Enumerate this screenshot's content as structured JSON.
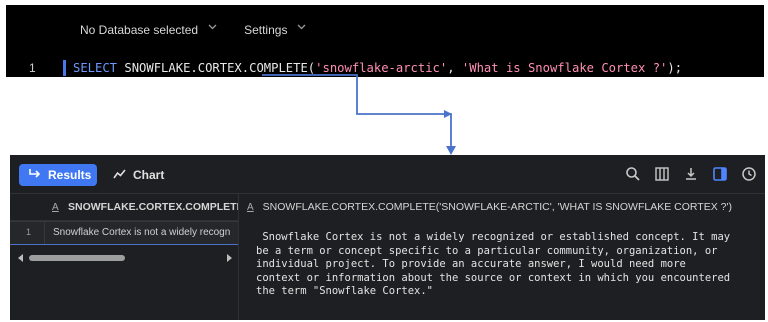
{
  "editor": {
    "database_selector": "No Database selected",
    "settings_label": "Settings",
    "line_number": "1",
    "code": {
      "select_kw": "SELECT",
      "function_call": " SNOWFLAKE.CORTEX.COMPLETE(",
      "model_arg": "'snowflake-arctic'",
      "separator": ", ",
      "prompt_arg": "'What is Snowflake Cortex ?'",
      "closing": ");"
    },
    "partial_line_text": "SELECT SNOWFLAKE.CORTEX.COMPLETE('snowflake-arctic', 'What is Snowflake Cortex ?');",
    "colors": {
      "background": "#000000",
      "keyword": "#6e98ff",
      "string": "#ff8fb3",
      "caret": "#4a78e8"
    }
  },
  "connector": {
    "color": "#4a73c9"
  },
  "results": {
    "tabs": {
      "results_label": "Results",
      "chart_label": "Chart"
    },
    "toolbar_icons": [
      "search-icon",
      "columns-icon",
      "download-icon",
      "split-panel-icon",
      "history-icon"
    ],
    "grid": {
      "type_indicator": "A",
      "column_header": "SNOWFLAKE.CORTEX.COMPLETE('S",
      "rows": [
        {
          "row_number": "1",
          "value": "Snowflake Cortex is not a widely recogn"
        }
      ]
    },
    "detail": {
      "type_indicator": "A",
      "column_header": "SNOWFLAKE.CORTEX.COMPLETE('SNOWFLAKE-ARCTIC', 'WHAT IS SNOWFLAKE CORTEX ?')",
      "lines": [
        " Snowflake Cortex is not a widely recognized or established concept. It may",
        "be a term or concept specific to a particular community, organization, or",
        "individual project. To provide an accurate answer, I would need more",
        "context or information about the source or context in which you encountered",
        "the term \"Snowflake Cortex.\""
      ]
    },
    "colors": {
      "background": "#1e1f22",
      "accent": "#3f78f2"
    }
  }
}
